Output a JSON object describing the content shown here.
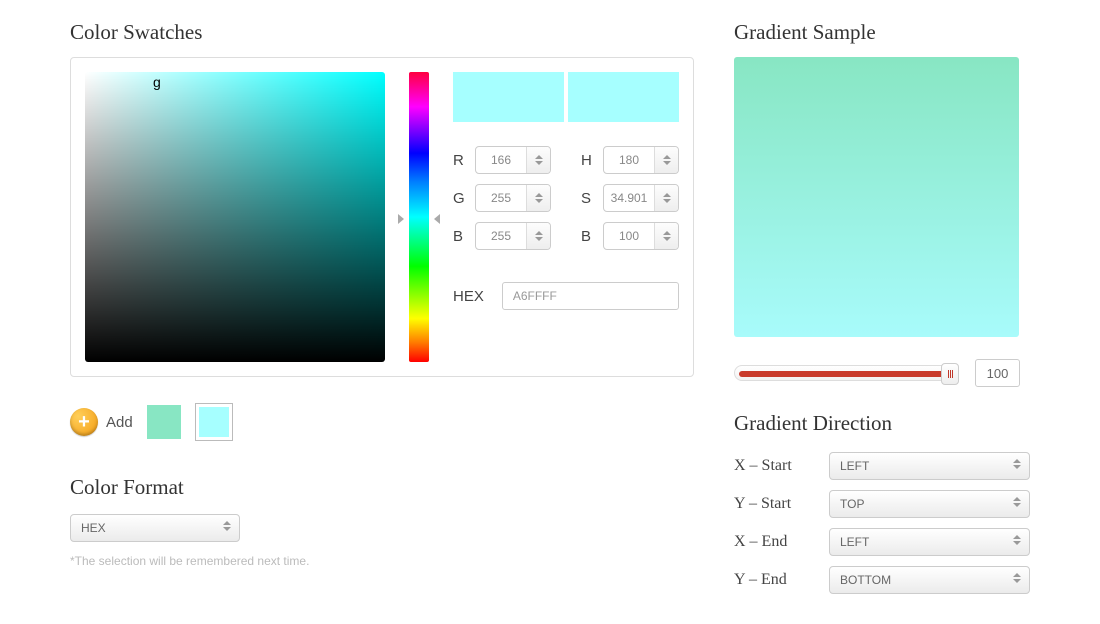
{
  "left": {
    "swatches_title": "Color Swatches",
    "rgb": {
      "r_label": "R",
      "g_label": "G",
      "b_label": "B",
      "r": "166",
      "g": "255",
      "b": "255"
    },
    "hsb": {
      "h_label": "H",
      "s_label": "S",
      "b_label": "B",
      "h": "180",
      "s": "34.901",
      "b": "100"
    },
    "hex_label": "HEX",
    "hex_value": "A6FFFF",
    "preview_color": "#A6FFFF",
    "add_label": "Add",
    "mini_swatches": [
      "#88E6C3",
      "#A6FFFF"
    ],
    "format_title": "Color Format",
    "format_selected": "HEX",
    "format_hint": "*The selection will be remembered next time."
  },
  "right": {
    "sample_title": "Gradient Sample",
    "slider_value": "100",
    "direction_title": "Gradient Direction",
    "dirs": {
      "xstart_label": "X – Start",
      "xstart": "LEFT",
      "ystart_label": "Y – Start",
      "ystart": "TOP",
      "xend_label": "X – End",
      "xend": "LEFT",
      "yend_label": "Y – End",
      "yend": "BOTTOM"
    }
  }
}
